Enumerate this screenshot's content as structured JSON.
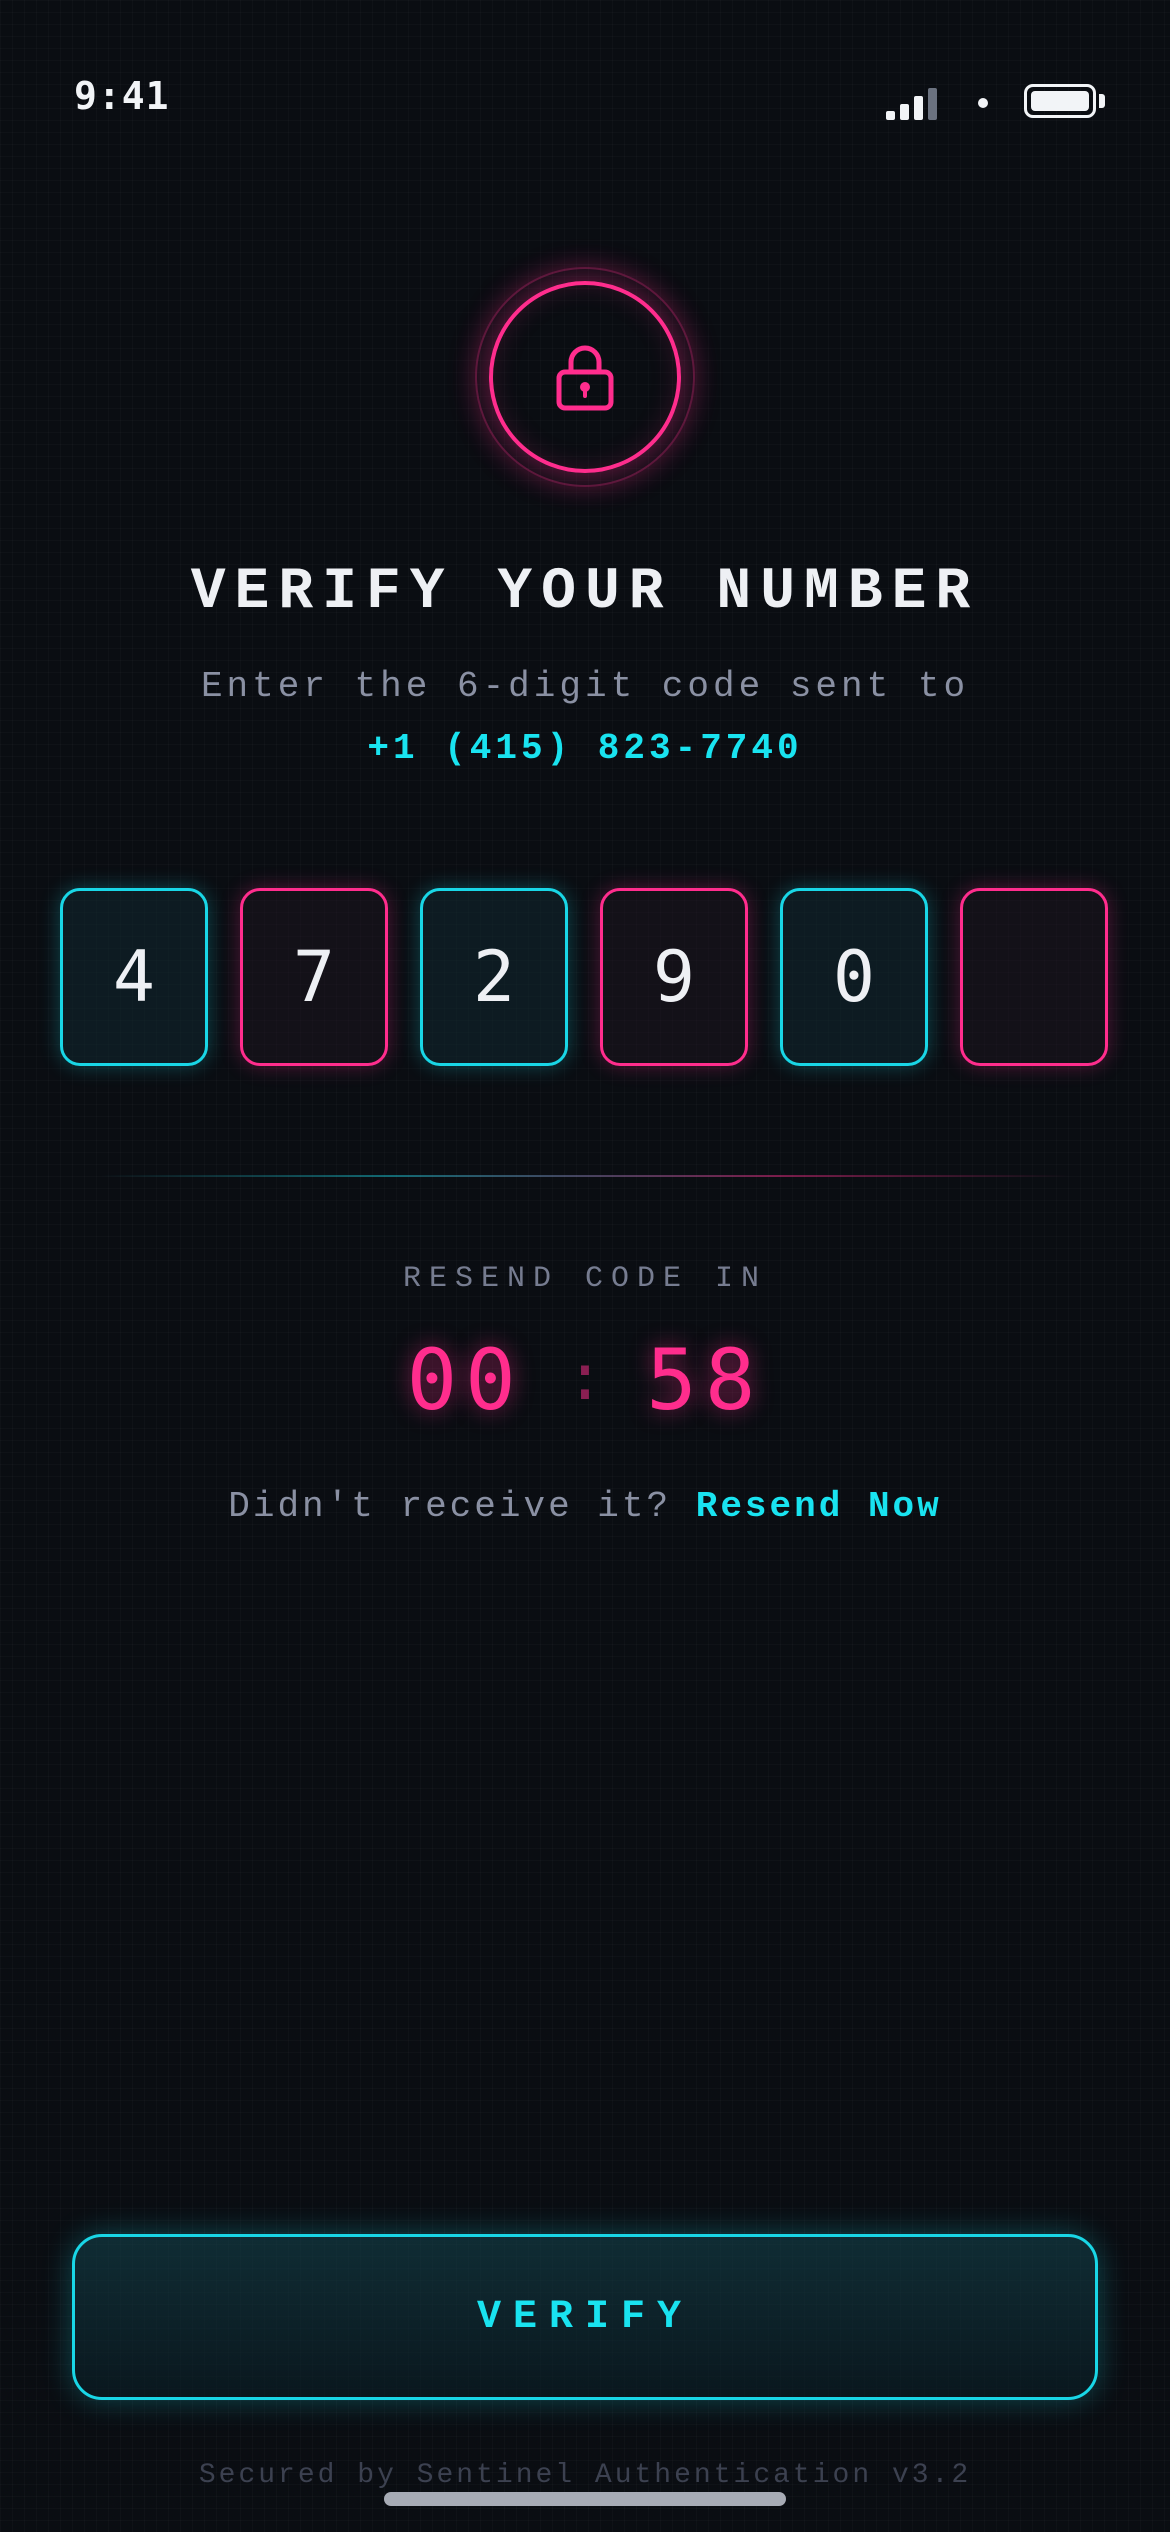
{
  "status_bar": {
    "time": "9:41",
    "icons": [
      "signal-icon",
      "wifi-icon",
      "battery-icon"
    ]
  },
  "header": {
    "icon": "lock-icon",
    "title": "VERIFY YOUR NUMBER",
    "subtitle": "Enter the 6-digit code sent to",
    "phone": "+1 (415) 823-7740"
  },
  "otp": {
    "digits": [
      "4",
      "7",
      "2",
      "9",
      "0",
      ""
    ]
  },
  "resend": {
    "label": "RESEND CODE IN",
    "minutes": "00",
    "separator": ":",
    "seconds": "58",
    "prompt": "Didn't receive it?",
    "link": "Resend Now"
  },
  "actions": {
    "verify_label": "VERIFY"
  },
  "footer": {
    "text": "Secured by Sentinel Authentication v3.2"
  },
  "colors": {
    "background": "#0a0d12",
    "accent_cyan": "#19e3f0",
    "accent_pink": "#ff2d8d",
    "text_primary": "#eef0f4",
    "text_muted": "#8a90a3"
  }
}
